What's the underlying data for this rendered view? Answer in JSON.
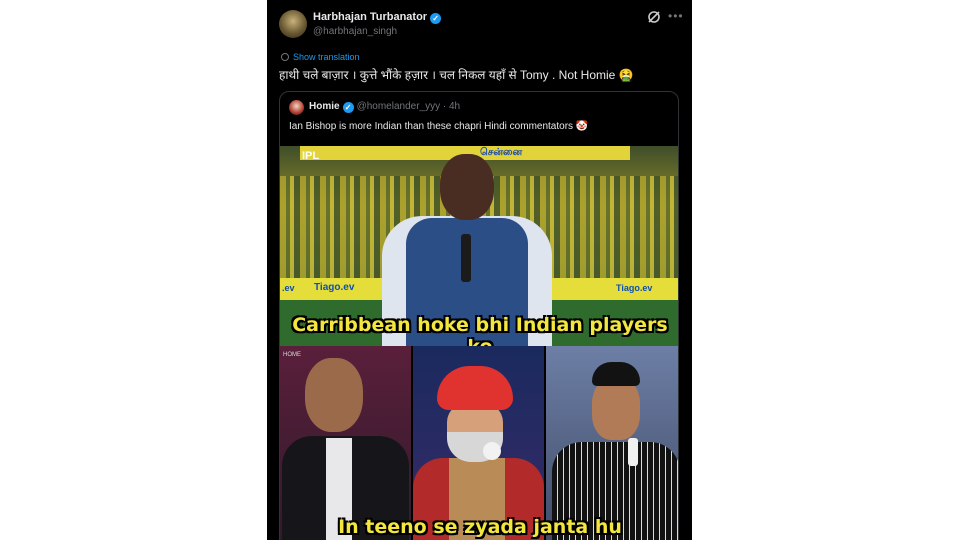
{
  "post": {
    "display_name": "Harbhajan Turbanator",
    "handle": "@harbhajan_singh",
    "show_translation": "Show translation",
    "text": "हाथी चले बाज़ार । कुत्ते भौंके हज़ार । चल निकल यहाँ से Tomy . Not Homie 🤮"
  },
  "quoted": {
    "name": "Homie",
    "handle_time": "@homelander_yyy · 4h",
    "text": "Ian Bishop is more Indian than these chapri Hindi commentators 🤡",
    "meme": {
      "logo": "IPL",
      "stand_text": "சென்னை",
      "adboard_left": ".ev",
      "adboard_mid": "Tiago.ev",
      "adboard_right": "Tiago.ev",
      "panel_label": "HOME",
      "caption_top": "Carribbean hoke bhi Indian players ko",
      "caption_bottom": "In teeno se zyada janta hu"
    }
  },
  "colors": {
    "background": "#000000",
    "accent": "#1d9bf0",
    "caption": "#f3e63c"
  },
  "icons": [
    "verified-badge-icon",
    "grok-icon",
    "more-icon",
    "translate-icon"
  ]
}
